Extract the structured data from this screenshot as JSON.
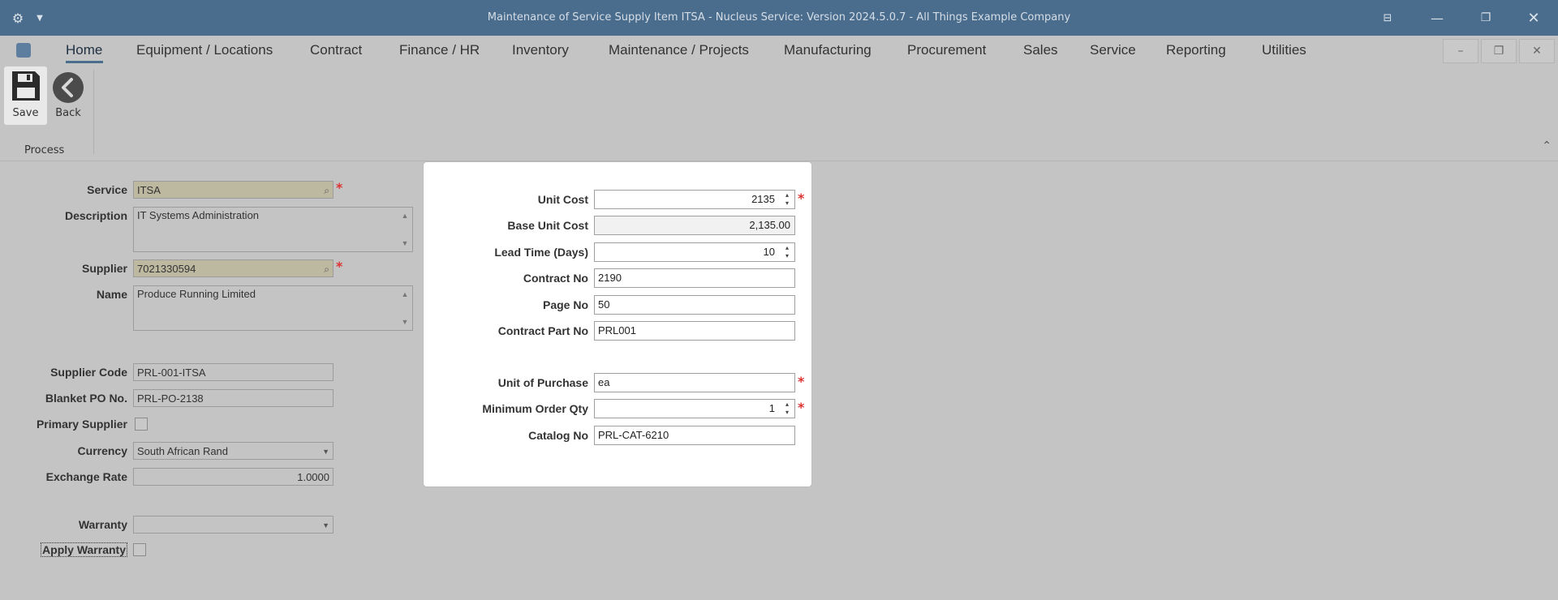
{
  "window": {
    "title": "Maintenance of Service Supply Item ITSA - Nucleus Service: Version 2024.5.0.7 - All Things Example Company"
  },
  "menu": [
    "Home",
    "Equipment / Locations",
    "Contract",
    "Finance / HR",
    "Inventory",
    "Maintenance / Projects",
    "Manufacturing",
    "Procurement",
    "Sales",
    "Service",
    "Reporting",
    "Utilities"
  ],
  "ribbon": {
    "save": "Save",
    "back": "Back",
    "group": "Process"
  },
  "form": {
    "service_label": "Service",
    "service": "ITSA",
    "description_label": "Description",
    "description": "IT Systems Administration",
    "supplier_label": "Supplier",
    "supplier": "7021330594",
    "name_label": "Name",
    "name": "Produce Running Limited",
    "supplier_code_label": "Supplier Code",
    "supplier_code": "PRL-001-ITSA",
    "blanket_po_label": "Blanket PO No.",
    "blanket_po": "PRL-PO-2138",
    "primary_supplier_label": "Primary Supplier",
    "currency_label": "Currency",
    "currency": "South African Rand",
    "exchange_rate_label": "Exchange Rate",
    "exchange_rate": "1.0000",
    "warranty_label": "Warranty",
    "warranty": "",
    "apply_warranty_label": "Apply Warranty"
  },
  "modal": {
    "unit_cost_label": "Unit Cost",
    "unit_cost": "2135",
    "base_unit_cost_label": "Base Unit Cost",
    "base_unit_cost": "2,135.00",
    "lead_time_label": "Lead Time (Days)",
    "lead_time": "10",
    "contract_no_label": "Contract No",
    "contract_no": "2190",
    "page_no_label": "Page No",
    "page_no": "50",
    "contract_part_label": "Contract Part No",
    "contract_part": "PRL001",
    "unit_of_purchase_label": "Unit of Purchase",
    "unit_of_purchase": "ea",
    "min_order_label": "Minimum Order Qty",
    "min_order": "1",
    "catalog_label": "Catalog No",
    "catalog": "PRL-CAT-6210"
  },
  "colors": {
    "titlebar": "#4a6c8d",
    "background": "#c4c4c4",
    "required": "#d33333",
    "lookup_field": "#bdb9a0"
  }
}
